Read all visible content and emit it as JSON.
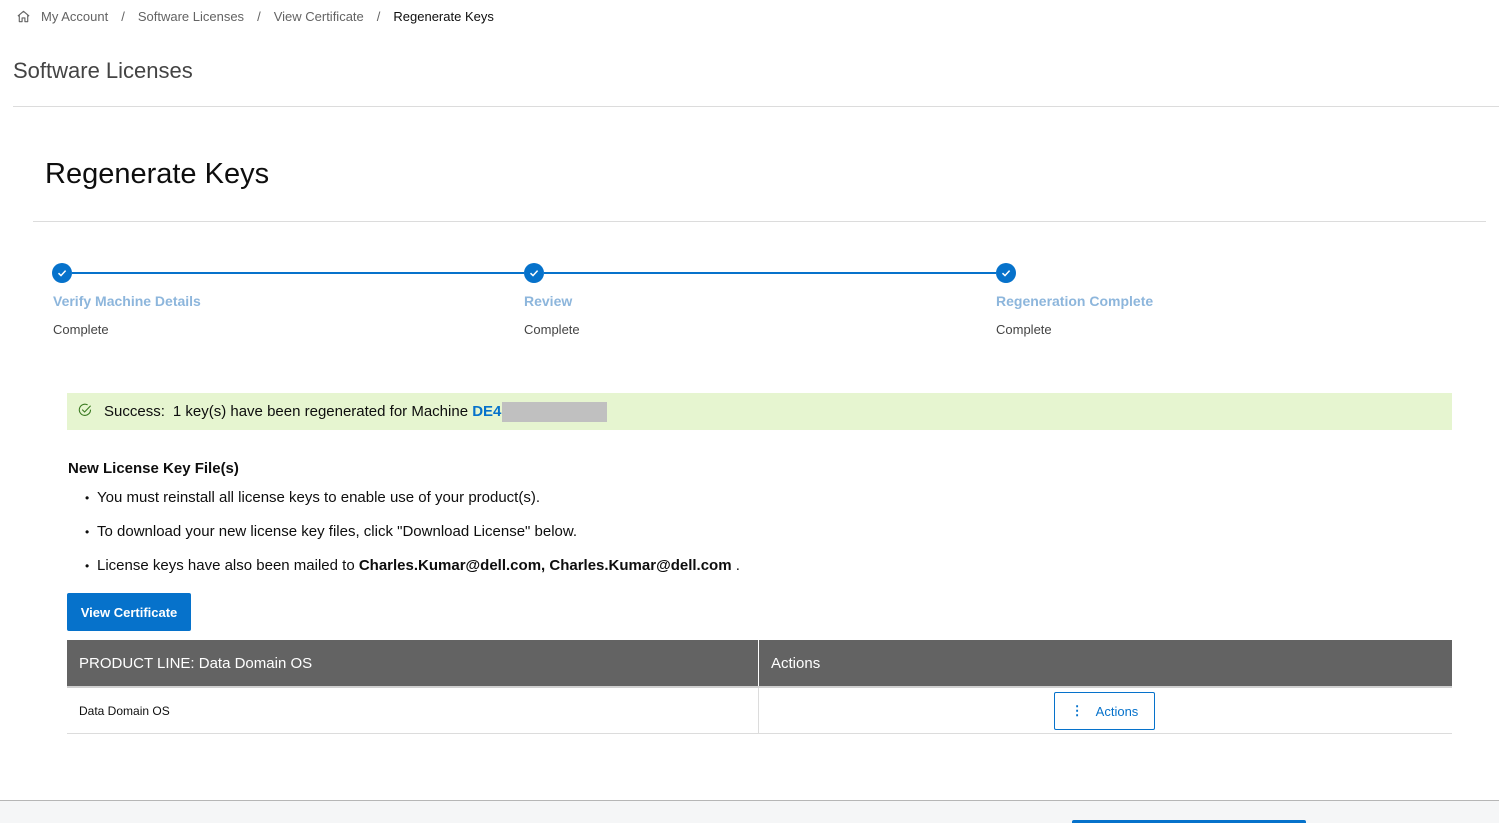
{
  "breadcrumb": {
    "items": [
      "My Account",
      "Software Licenses",
      "View Certificate",
      "Regenerate Keys"
    ],
    "separator": "/"
  },
  "page": {
    "title": "Software Licenses",
    "section_title": "Regenerate Keys"
  },
  "stepper": {
    "steps": [
      {
        "label": "Verify Machine Details",
        "status": "Complete"
      },
      {
        "label": "Review",
        "status": "Complete"
      },
      {
        "label": "Regeneration Complete",
        "status": "Complete"
      }
    ]
  },
  "alert": {
    "label": "Success:",
    "message": "1 key(s) have been regenerated for Machine",
    "machine_visible": "DE4"
  },
  "keys": {
    "heading": "New License Key File(s)",
    "bullet_1": "You must reinstall all license keys to enable use of your product(s).",
    "bullet_2": "To download your new license key files, click \"Download License\" below.",
    "bullet_3_prefix": "License keys have also been mailed to",
    "bullet_3_emails": "Charles.Kumar@dell.com, Charles.Kumar@dell.com",
    "bullet_3_suffix": "."
  },
  "buttons": {
    "view_certificate": "View Certificate",
    "actions": "Actions"
  },
  "table": {
    "headers": [
      "PRODUCT LINE: Data Domain OS",
      "Actions"
    ],
    "rows": [
      {
        "product": "Data Domain OS"
      }
    ]
  },
  "colors": {
    "accent": "#0672cb",
    "success_bg": "#e6f5d0",
    "table_header_bg": "#636363",
    "step_label": "#8db6dc"
  }
}
